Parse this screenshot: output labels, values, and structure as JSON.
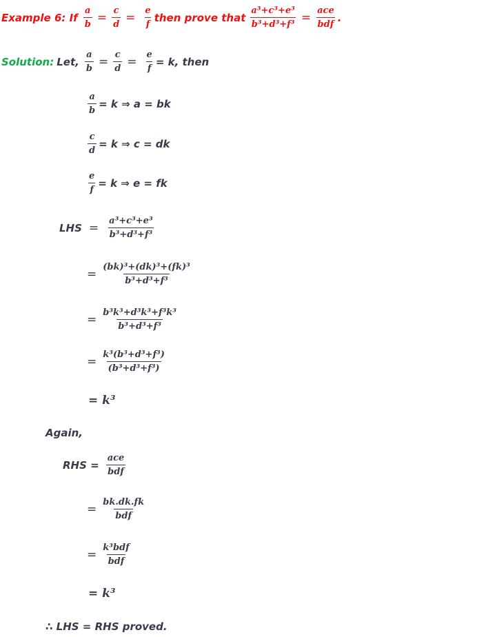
{
  "header": {
    "label": "Example 6: If",
    "frac1": {
      "num": "a",
      "den": "b"
    },
    "frac2": {
      "num": "c",
      "den": "d"
    },
    "frac3": {
      "num": "e",
      "den": "f"
    },
    "mid_text": "then prove that",
    "frac4": {
      "num": "a³+c³+e³",
      "den": "b³+d³+f³"
    },
    "frac5": {
      "num": "ace",
      "den": "bdf"
    },
    "eq": "=",
    "end": "."
  },
  "solution": {
    "label": "Solution:",
    "let": "Let,",
    "frac1": {
      "num": "a",
      "den": "b"
    },
    "frac2": {
      "num": "c",
      "den": "d"
    },
    "frac3": {
      "num": "e",
      "den": "f"
    },
    "tail": "= k, then",
    "eq": "="
  },
  "steps": [
    {
      "frac": {
        "num": "a",
        "den": "b"
      },
      "rest": "= k ⇒ a = bk"
    },
    {
      "frac": {
        "num": "c",
        "den": "d"
      },
      "rest": "= k ⇒ c = dk"
    },
    {
      "frac": {
        "num": "e",
        "den": "f"
      },
      "rest": "= k ⇒ e = fk"
    }
  ],
  "lhs": {
    "label": "LHS",
    "eq": "=",
    "lines": [
      {
        "num": "a³+c³+e³",
        "den": "b³+d³+f³"
      },
      {
        "num": "(bk)³+(dk)³+(fk)³",
        "den": "b³+d³+f³"
      },
      {
        "num": "b³k³+d³k³+f³k³",
        "den": "b³+d³+f³"
      },
      {
        "num": "k³(b³+d³+f³)",
        "den": "(b³+d³+f³)"
      }
    ],
    "result": "= k³"
  },
  "again": "Again,",
  "rhs": {
    "label": "RHS =",
    "eq": "=",
    "lines": [
      {
        "num": "ace",
        "den": "bdf"
      },
      {
        "num": "bk.dk.fk",
        "den": "bdf"
      },
      {
        "num": "k³bdf",
        "den": "bdf"
      }
    ],
    "result": "= k³"
  },
  "conclusion": "∴ LHS = RHS proved.",
  "colors": {
    "header": "#ee1111",
    "solution_label": "#14a84a",
    "body": "#3a3a4a"
  }
}
